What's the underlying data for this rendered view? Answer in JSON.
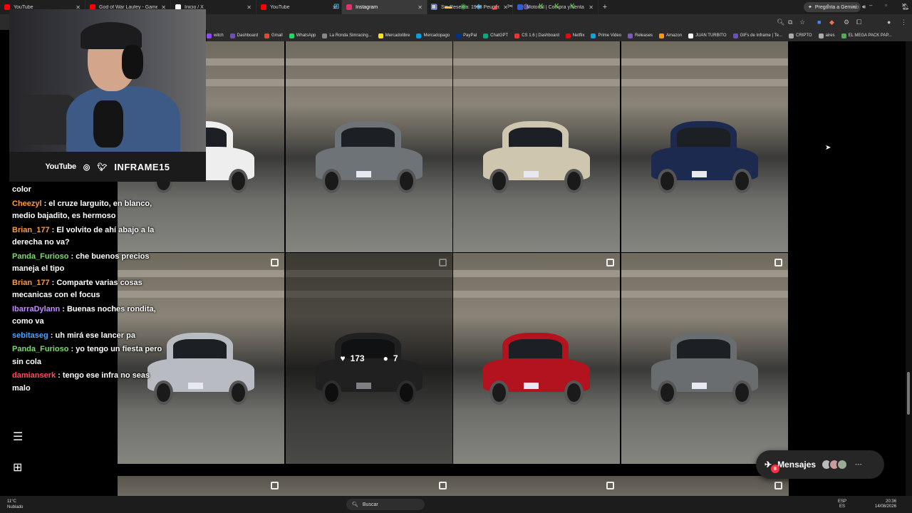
{
  "browser": {
    "tabs": [
      {
        "label": "YouTube",
        "color": "#ff0000"
      },
      {
        "label": "God of War Laufey - Gameplay",
        "color": "#ff0000"
      },
      {
        "label": "Inicio / X",
        "color": "#ffffff"
      },
      {
        "label": "YouTube",
        "color": "#ff0000"
      },
      {
        "label": "Instagram",
        "color": "#e1306c",
        "active": true
      },
      {
        "label": "Sin Reserva: 1968 Peugeot 404",
        "color": "#2f5fd0"
      },
      {
        "label": "Motordil | Compra y Venta de Autos",
        "color": "#2f5fd0"
      }
    ],
    "gemini_label": "Pregunta a Gemini",
    "bookmarks": [
      {
        "label": "witch",
        "color": "#9146ff"
      },
      {
        "label": "Dashboard",
        "color": "#6b4fbb"
      },
      {
        "label": "Gmail",
        "color": "#ea4335"
      },
      {
        "label": "WhatsApp",
        "color": "#25d366"
      },
      {
        "label": "La Ronda Simracing...",
        "color": "#888888"
      },
      {
        "label": "Mercadolibre",
        "color": "#ffe600"
      },
      {
        "label": "Mercadopago",
        "color": "#009ee3"
      },
      {
        "label": "PayPal",
        "color": "#003087"
      },
      {
        "label": "ChatGPT",
        "color": "#10a37f"
      },
      {
        "label": "CS 1.6 | Dashboard",
        "color": "#e53935"
      },
      {
        "label": "Netflix",
        "color": "#e50914"
      },
      {
        "label": "Prime Video",
        "color": "#00a8e1"
      },
      {
        "label": "Releases",
        "color": "#7e57c2"
      },
      {
        "label": "Amazon",
        "color": "#ff9900"
      },
      {
        "label": "JUAN TURBITO",
        "color": "#ffffff"
      },
      {
        "label": "GIFs de Inframe | Te...",
        "color": "#6b4fbb"
      },
      {
        "label": "CRIPTO",
        "color": "#aaaaaa"
      },
      {
        "label": "aires",
        "color": "#aaaaaa"
      },
      {
        "label": "EL MEGA PACK PAP...",
        "color": "#4caf50"
      }
    ]
  },
  "stream": {
    "platform": "YouTube",
    "handle": "INFRAME15"
  },
  "chat": [
    {
      "user": "",
      "text": "color",
      "color": "#ffffff"
    },
    {
      "user": "Cheezyl",
      "text": ": el cruze larguito, en blanco, medio bajadito, es hermoso",
      "color": "#ff9a3c"
    },
    {
      "user": "Brian_177",
      "text": ": El volvito de ahí abajo a la derecha no va?",
      "color": "#ff9a3c"
    },
    {
      "user": "Panda_Furioso",
      "text": ": che buenos precios maneja el tipo",
      "color": "#7ddc6b"
    },
    {
      "user": "Brian_177",
      "text": ": Comparte varias cosas mecanicas con el focus",
      "color": "#ff9a3c"
    },
    {
      "user": "IbarraDylann",
      "text": ": Buenas noches rondita, como va",
      "color": "#c58cff"
    },
    {
      "user": "sebitaseg",
      "text": ": uh mirá ese lancer pa",
      "color": "#4fa3ff"
    },
    {
      "user": "Panda_Furioso",
      "text": ": yo tengo un fiesta pero sin cola",
      "color": "#7ddc6b"
    },
    {
      "user": "damianserk",
      "text": ": tengo ese infra no seas malo",
      "color": "#ff4a5a"
    }
  ],
  "grid": {
    "posts": [
      {
        "car": "white hatchback",
        "color": "#eeeeee"
      },
      {
        "car": "grey suv",
        "color": "#6e7378"
      },
      {
        "car": "champagne suv",
        "color": "#cfc6b0"
      },
      {
        "car": "navy hatchback",
        "color": "#1d2a4f"
      },
      {
        "car": "silver sedan",
        "color": "#b8bcc2",
        "multi": true
      },
      {
        "car": "dark sedan",
        "color": "#3b3b3b",
        "multi": true,
        "hover": true,
        "likes": "173",
        "comments": "7"
      },
      {
        "car": "red suv",
        "color": "#b3121f",
        "multi": true
      },
      {
        "car": "grey crossover",
        "color": "#6a6d70",
        "multi": true
      }
    ]
  },
  "messages": {
    "label": "Mensajes",
    "badge": "8"
  },
  "taskbar": {
    "weather_temp": "11°C",
    "weather_desc": "Nublado",
    "search_placeholder": "Buscar",
    "lang1": "ESP",
    "lang2": "ES",
    "time": "20:36",
    "date": "14/08/2026"
  }
}
